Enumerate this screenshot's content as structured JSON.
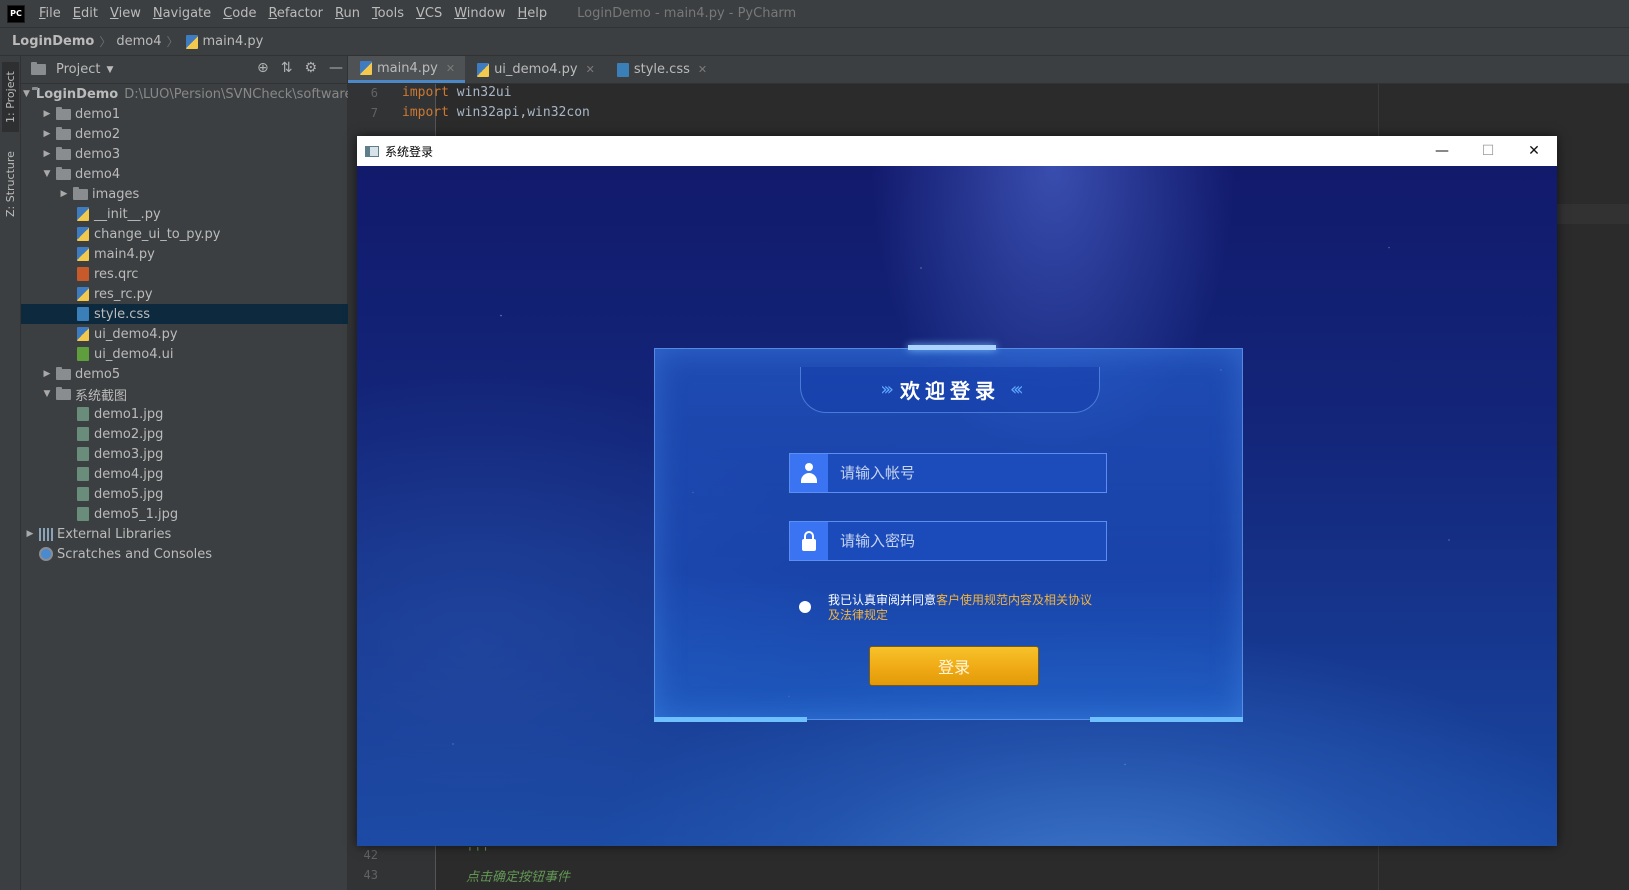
{
  "ide": {
    "logo_text": "PC",
    "menu": [
      "File",
      "Edit",
      "View",
      "Navigate",
      "Code",
      "Refactor",
      "Run",
      "Tools",
      "VCS",
      "Window",
      "Help"
    ],
    "window_title": "LoginDemo - main4.py - PyCharm",
    "breadcrumb": [
      "LoginDemo",
      "demo4",
      "main4.py"
    ],
    "tool_tabs": [
      "1: Project",
      "Z: Structure"
    ],
    "project_panel": {
      "title": "Project",
      "root_name": "LoginDemo",
      "root_path": "D:\\LUO\\Persion\\SVNCheck\\software",
      "items": [
        {
          "label": "demo1",
          "type": "folder"
        },
        {
          "label": "demo2",
          "type": "folder"
        },
        {
          "label": "demo3",
          "type": "folder"
        },
        {
          "label": "demo4",
          "type": "folder"
        },
        {
          "label": "images",
          "type": "folder"
        },
        {
          "label": "__init__.py",
          "type": "py"
        },
        {
          "label": "change_ui_to_py.py",
          "type": "py"
        },
        {
          "label": "main4.py",
          "type": "py"
        },
        {
          "label": "res.qrc",
          "type": "qrc"
        },
        {
          "label": "res_rc.py",
          "type": "py"
        },
        {
          "label": "style.css",
          "type": "css"
        },
        {
          "label": "ui_demo4.py",
          "type": "py"
        },
        {
          "label": "ui_demo4.ui",
          "type": "ui"
        },
        {
          "label": "demo5",
          "type": "folder"
        },
        {
          "label": "系统截图",
          "type": "folder"
        },
        {
          "label": "demo1.jpg",
          "type": "jpg"
        },
        {
          "label": "demo2.jpg",
          "type": "jpg"
        },
        {
          "label": "demo3.jpg",
          "type": "jpg"
        },
        {
          "label": "demo4.jpg",
          "type": "jpg"
        },
        {
          "label": "demo5.jpg",
          "type": "jpg"
        },
        {
          "label": "demo5_1.jpg",
          "type": "jpg"
        },
        {
          "label": "External Libraries",
          "type": "lib"
        },
        {
          "label": "Scratches and Consoles",
          "type": "scratch"
        }
      ]
    },
    "editor_tabs": [
      {
        "label": "main4.py",
        "active": true
      },
      {
        "label": "ui_demo4.py",
        "active": false
      },
      {
        "label": "style.css",
        "active": false
      }
    ],
    "code_lines": [
      {
        "num": "6",
        "keyword": "import",
        "rest": " win32ui"
      },
      {
        "num": "7",
        "keyword": "import",
        "rest": " win32api,win32con"
      },
      {
        "num": "42",
        "keyword": "",
        "rest": "'''"
      },
      {
        "num": "43",
        "keyword": "",
        "rest": "点击确定按钮事件"
      }
    ]
  },
  "dialog": {
    "title": "系统登录",
    "controls": {
      "minimize": "—",
      "maximize": "☐",
      "close": "✕"
    },
    "welcome": "欢迎登录",
    "chevrons_left": "›››",
    "chevrons_right": "‹‹‹",
    "username_placeholder": "请输入帐号",
    "password_placeholder": "请输入密码",
    "agree_prefix": "我已认真审阅并同意",
    "agree_link": "客户使用规范内容及相关协议及法律规定",
    "login_button": "登录",
    "accent_color": "#f0aa14"
  }
}
